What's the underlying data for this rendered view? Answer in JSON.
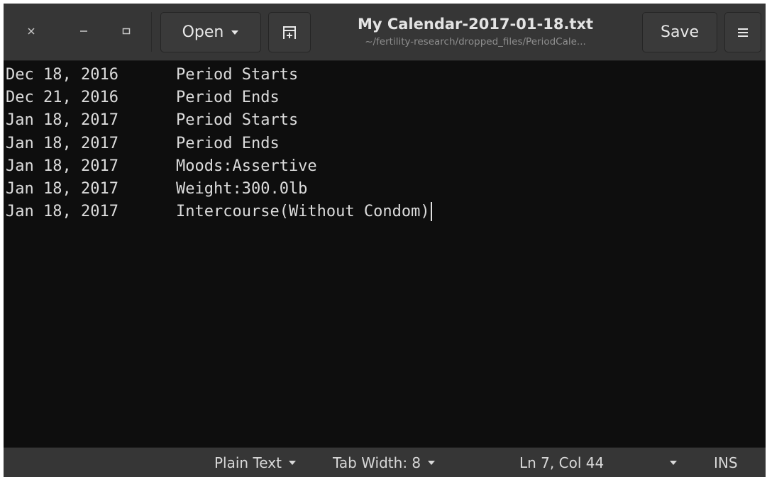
{
  "window": {
    "title": "My Calendar-2017-01-18.txt",
    "subtitle": "~/fertility-research/dropped_files/PeriodCale..."
  },
  "headerbar": {
    "open_label": "Open",
    "save_label": "Save",
    "icons": {
      "close": "close-icon",
      "minimize": "minimize-icon",
      "maximize": "maximize-icon",
      "open_dropdown": "chevron-down-icon",
      "new_tab": "new-document-icon",
      "menu": "hamburger-menu-icon"
    }
  },
  "editor": {
    "lines": [
      {
        "date": "Dec 18, 2016",
        "text": "Period Starts"
      },
      {
        "date": "Dec 21, 2016",
        "text": "Period Ends"
      },
      {
        "date": "Jan 18, 2017",
        "text": "Period Starts"
      },
      {
        "date": "Jan 18, 2017",
        "text": "Period Ends"
      },
      {
        "date": "Jan 18, 2017",
        "text": "Moods:Assertive"
      },
      {
        "date": "Jan 18, 2017",
        "text": "Weight:300.0lb"
      },
      {
        "date": "Jan 18, 2017",
        "text": "Intercourse(Without Condom)"
      }
    ]
  },
  "statusbar": {
    "language": "Plain Text",
    "tab_width": "Tab Width: 8",
    "position": "Ln 7, Col 44",
    "insert_mode": "INS"
  },
  "colors": {
    "headerbar_bg": "#363636",
    "editor_bg": "#0e0e0e",
    "editor_text": "#dcdcdc"
  }
}
